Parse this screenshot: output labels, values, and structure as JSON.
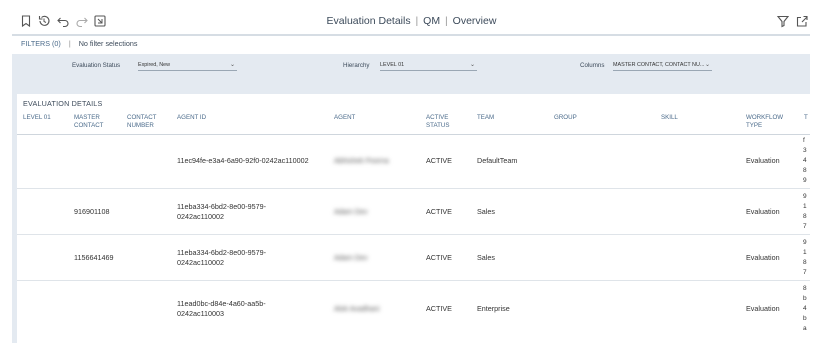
{
  "title": {
    "part1": "Evaluation Details",
    "part2": "QM",
    "part3": "Overview",
    "sep": "|"
  },
  "filters": {
    "label": "FILTERS (0)",
    "sep": "|",
    "summary": "No filter selections"
  },
  "filter_fields": [
    {
      "label": "Evaluation Status",
      "value": "Expired, New"
    },
    {
      "label": "Hierarchy",
      "value": "LEVEL 01"
    },
    {
      "label": "Columns",
      "value": "MASTER CONTACT, CONTACT NU..."
    }
  ],
  "section_title": "EVALUATION DETAILS",
  "columns": [
    {
      "line1": "LEVEL 01",
      "line2": ""
    },
    {
      "line1": "MASTER",
      "line2": "CONTACT"
    },
    {
      "line1": "CONTACT",
      "line2": "NUMBER"
    },
    {
      "line1": "AGENT ID",
      "line2": ""
    },
    {
      "line1": "AGENT",
      "line2": ""
    },
    {
      "line1": "ACTIVE",
      "line2": "STATUS"
    },
    {
      "line1": "TEAM",
      "line2": ""
    },
    {
      "line1": "GROUP",
      "line2": ""
    },
    {
      "line1": "SKILL",
      "line2": ""
    },
    {
      "line1": "WORKFLOW",
      "line2": "TYPE"
    },
    {
      "line1": "T",
      "line2": ""
    }
  ],
  "rows": [
    {
      "master_contact": "",
      "agent_id_1": "11ec94fe-e3a4-6a90-92f0-0242ac110002",
      "agent_id_2": "",
      "agent": "Abhishek Poorna",
      "active_status": "ACTIVE",
      "team": "DefaultTeam",
      "group": "",
      "skill": "",
      "workflow_type": "Evaluation",
      "t": [
        "f",
        "3",
        "4",
        "8",
        "9"
      ]
    },
    {
      "master_contact": "916901108",
      "agent_id_1": "11eba334-6bd2-8e00-9579-",
      "agent_id_2": "0242ac110002",
      "agent": "Adam Dev",
      "active_status": "ACTIVE",
      "team": "Sales",
      "group": "",
      "skill": "",
      "workflow_type": "Evaluation",
      "t": [
        "9",
        "1",
        "8",
        "7"
      ]
    },
    {
      "master_contact": "1156641469",
      "agent_id_1": "11eba334-6bd2-8e00-9579-",
      "agent_id_2": "0242ac110002",
      "agent": "Adam Dev",
      "active_status": "ACTIVE",
      "team": "Sales",
      "group": "",
      "skill": "",
      "workflow_type": "Evaluation",
      "t": [
        "9",
        "1",
        "8",
        "7"
      ]
    },
    {
      "master_contact": "",
      "agent_id_1": "11ead0bc-d84e-4a60-aa5b-",
      "agent_id_2": "0242ac110003",
      "agent": "Alok Avadhani",
      "active_status": "ACTIVE",
      "team": "Enterprise",
      "group": "",
      "skill": "",
      "workflow_type": "Evaluation",
      "t": [
        "8",
        "b",
        "4",
        "b",
        "a"
      ]
    }
  ],
  "icons": {
    "bookmark": "bookmark-icon",
    "history": "history-icon",
    "undo": "undo-icon",
    "redo": "redo-icon",
    "reset": "reset-icon",
    "filter": "filter-icon",
    "share": "share-icon"
  }
}
